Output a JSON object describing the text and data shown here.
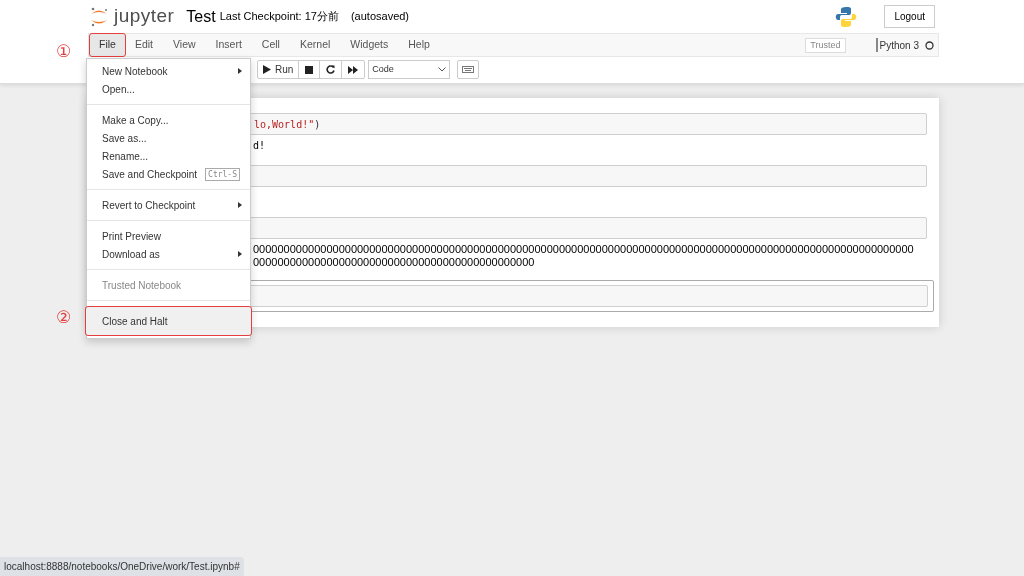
{
  "header": {
    "logo": "jupyter",
    "notebook_name": "Test",
    "checkpoint": "Last Checkpoint: 17分前",
    "autosave": "(autosaved)",
    "logout": "Logout"
  },
  "menubar": [
    {
      "label": "File",
      "selected": true
    },
    {
      "label": "Edit",
      "selected": false
    },
    {
      "label": "View",
      "selected": false
    },
    {
      "label": "Insert",
      "selected": false
    },
    {
      "label": "Cell",
      "selected": false
    },
    {
      "label": "Kernel",
      "selected": false
    },
    {
      "label": "Widgets",
      "selected": false
    },
    {
      "label": "Help",
      "selected": false
    }
  ],
  "trusted": "Trusted",
  "kernel": "Python 3",
  "toolbar": {
    "run": "Run",
    "cell_type": "Code"
  },
  "cells": [
    {
      "selected": false,
      "input": [
        {
          "kind": "string",
          "text": "lo,World!\""
        },
        {
          "kind": "plain",
          "text": ")"
        }
      ],
      "output": [
        "d!"
      ]
    },
    {
      "selected": false
    },
    {
      "selected": false,
      "output": [
        "000000000000000000000000000000000000000000000000000000000000000000000000000000000000000000000000000000000000",
        "0000000000000000000000000000000000000000000000"
      ]
    },
    {
      "selected": true
    }
  ],
  "file_menu": [
    {
      "kind": "item",
      "label": "New Notebook",
      "submenu": true
    },
    {
      "kind": "item",
      "label": "Open..."
    },
    {
      "kind": "divider"
    },
    {
      "kind": "item",
      "label": "Make a Copy..."
    },
    {
      "kind": "item",
      "label": "Save as..."
    },
    {
      "kind": "item",
      "label": "Rename..."
    },
    {
      "kind": "item",
      "label": "Save and Checkpoint",
      "shortcut": "Ctrl-S"
    },
    {
      "kind": "divider"
    },
    {
      "kind": "item",
      "label": "Revert to Checkpoint",
      "submenu": true
    },
    {
      "kind": "divider"
    },
    {
      "kind": "item",
      "label": "Print Preview"
    },
    {
      "kind": "item",
      "label": "Download as",
      "submenu": true
    },
    {
      "kind": "divider"
    },
    {
      "kind": "item",
      "label": "Trusted Notebook",
      "disabled": true
    },
    {
      "kind": "divider"
    },
    {
      "kind": "item",
      "label": "Close and Halt",
      "highlighted": true
    }
  ],
  "annotations": [
    "①",
    "②"
  ],
  "status_url": "localhost:8888/notebooks/OneDrive/work/Test.ipynb#"
}
